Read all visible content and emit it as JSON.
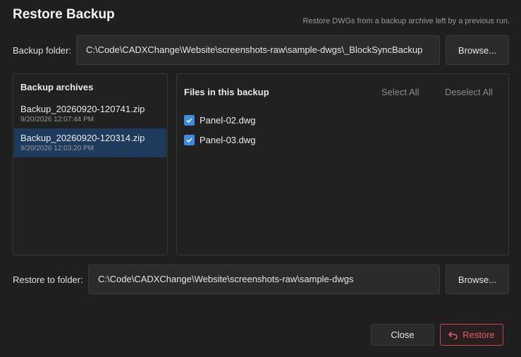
{
  "dialog": {
    "title": "Restore Backup",
    "subtitle": "Restore DWGs from a backup archive left by a previous run."
  },
  "backup_folder": {
    "label": "Backup folder:",
    "value": "C:\\Code\\CADXChange\\Website\\screenshots-raw\\sample-dwgs\\_BlockSyncBackup",
    "browse_label": "Browse..."
  },
  "archives": {
    "heading": "Backup archives",
    "items": [
      {
        "name": "Backup_20260920-120741.zip",
        "date": "9/20/2026 12:07:44 PM",
        "selected": false
      },
      {
        "name": "Backup_20260920-120314.zip",
        "date": "9/20/2026 12:03:20 PM",
        "selected": true
      }
    ]
  },
  "files": {
    "heading": "Files in this backup",
    "select_all_label": "Select All",
    "deselect_all_label": "Deselect All",
    "items": [
      {
        "name": "Panel-02.dwg",
        "checked": true
      },
      {
        "name": "Panel-03.dwg",
        "checked": true
      }
    ]
  },
  "restore_folder": {
    "label": "Restore to folder:",
    "value": "C:\\Code\\CADXChange\\Website\\screenshots-raw\\sample-dwgs",
    "browse_label": "Browse..."
  },
  "actions": {
    "close_label": "Close",
    "restore_label": "Restore",
    "restore_icon": "undo-arrow-icon"
  },
  "colors": {
    "background": "#1f1f1f",
    "selection": "#1e3a5c",
    "checkbox": "#3d8ce0",
    "danger": "#e06060"
  }
}
